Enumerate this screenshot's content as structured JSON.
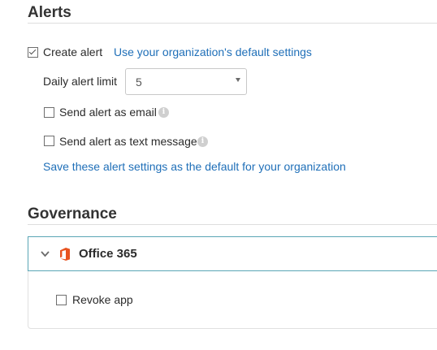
{
  "alerts": {
    "title": "Alerts",
    "create_alert": {
      "label": "Create alert",
      "checked": true
    },
    "default_settings_link": "Use your organization's default settings",
    "daily_limit": {
      "label": "Daily alert limit",
      "value": "5"
    },
    "send_email": {
      "label": "Send alert as email",
      "checked": false
    },
    "send_text": {
      "label": "Send alert as text message",
      "checked": false
    },
    "save_default_link": "Save these alert settings as the default for your organization"
  },
  "governance": {
    "title": "Governance",
    "app": {
      "name": "Office 365",
      "expanded": true
    },
    "revoke_app": {
      "label": "Revoke app",
      "checked": false
    }
  },
  "colors": {
    "link": "#1f6fb8",
    "panel_border": "#5aa6b5",
    "office_logo": "#e8531f"
  }
}
